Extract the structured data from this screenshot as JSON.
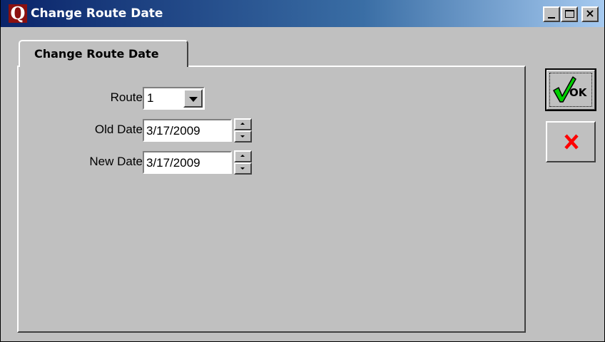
{
  "window": {
    "title": "Change Route Date",
    "icon_letter": "Q",
    "controls": {
      "minimize": "minimize",
      "maximize": "maximize",
      "close": "×"
    }
  },
  "tabs": [
    {
      "label": "Change Route Date",
      "selected": true
    }
  ],
  "form": {
    "route": {
      "label": "Route",
      "value": "1"
    },
    "old_date": {
      "label": "Old Date",
      "value": "3/17/2009"
    },
    "new_date": {
      "label": "New Date",
      "value": "3/17/2009"
    }
  },
  "buttons": {
    "ok": {
      "label": "OK",
      "icon": "check-icon",
      "icon_color": "#00c000"
    },
    "cancel": {
      "icon": "x-icon",
      "icon_color": "#ff0000"
    }
  }
}
